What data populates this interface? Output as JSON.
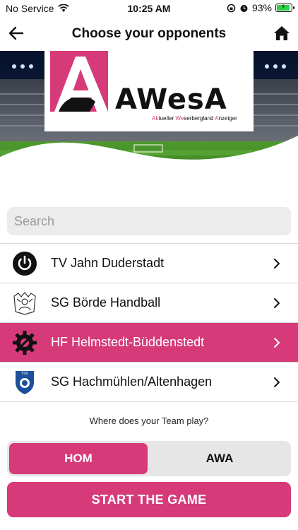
{
  "status_bar": {
    "carrier": "No Service",
    "time": "10:25 AM",
    "battery": "93%",
    "battery_level": 0.93
  },
  "nav": {
    "title": "Choose your opponents"
  },
  "logo": {
    "wordmark": "AWesA",
    "tagline_parts": [
      "Ak",
      "tueller ",
      "We",
      "serbergland ",
      "A",
      "nzeiger"
    ]
  },
  "search": {
    "placeholder": "Search",
    "value": ""
  },
  "teams": [
    {
      "name": "TV Jahn Duderstadt",
      "icon": "power-icon",
      "selected": false
    },
    {
      "name": "SG Börde Handball",
      "icon": "crest-outline-icon",
      "selected": false
    },
    {
      "name": "HF Helmstedt-Büddenstedt",
      "icon": "gear-wrench-icon",
      "selected": true
    },
    {
      "name": "SG Hachmühlen/Altenhagen",
      "icon": "tsv-shield-icon",
      "selected": false
    }
  ],
  "question": "Where does your Team play?",
  "venue_toggle": {
    "home_label": "HOM",
    "away_label": "AWA",
    "selected": "home"
  },
  "start_button": "START THE GAME",
  "colors": {
    "accent": "#d63a79",
    "list_divider": "#d8d8d8",
    "segment_bg": "#e6e6e6"
  }
}
